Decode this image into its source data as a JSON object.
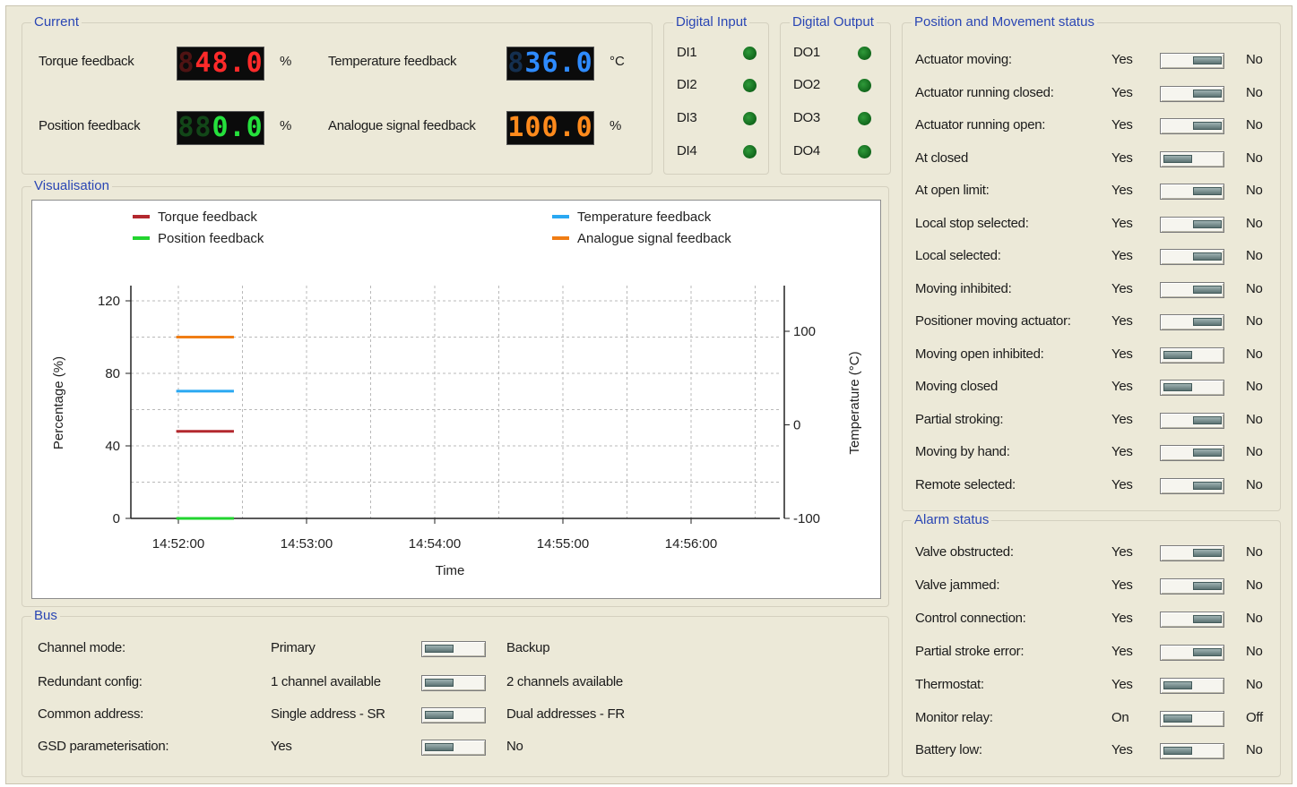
{
  "current": {
    "title": "Current",
    "torque": {
      "label": "Torque feedback",
      "display": "48.0",
      "unit": "%",
      "color": "#ff2a2a"
    },
    "temperature": {
      "label": "Temperature feedback",
      "display": "36.0",
      "unit": "°C",
      "color": "#2e8bff"
    },
    "position": {
      "label": "Position feedback",
      "display": "0.0",
      "unit": "%",
      "color": "#25e03c"
    },
    "analogue": {
      "label": "Analogue signal feedback",
      "display": "100.0",
      "unit": "%",
      "color": "#ff8a1c"
    }
  },
  "digital_input": {
    "title": "Digital Input",
    "items": [
      {
        "label": "DI1",
        "led": "led-icon"
      },
      {
        "label": "DI2",
        "led": "led-icon"
      },
      {
        "label": "DI3",
        "led": "led-icon"
      },
      {
        "label": "DI4",
        "led": "led-icon"
      }
    ]
  },
  "digital_output": {
    "title": "Digital Output",
    "items": [
      {
        "label": "DO1",
        "led": "led-icon"
      },
      {
        "label": "DO2",
        "led": "led-icon"
      },
      {
        "label": "DO3",
        "led": "led-icon"
      },
      {
        "label": "DO4",
        "led": "led-icon"
      }
    ]
  },
  "visualisation": {
    "title": "Visualisation"
  },
  "chart_data": {
    "type": "line",
    "xlabel": "Time",
    "ylabel": "Percentage (%)",
    "y2label": "Temperature (°C)",
    "ylim": [
      0,
      120
    ],
    "y2lim": [
      -100,
      100
    ],
    "yticks": [
      0,
      40,
      80,
      120
    ],
    "y2ticks": [
      -100,
      0,
      100
    ],
    "x_ticks": [
      "14:52:00",
      "14:53:00",
      "14:54:00",
      "14:55:00",
      "14:56:00"
    ],
    "grid": true,
    "legend_position": "top",
    "series": [
      {
        "name": "Torque feedback",
        "color": "#b3282e",
        "axis": "left",
        "x": [
          "14:51:59",
          "14:52:26"
        ],
        "y": [
          48,
          48
        ]
      },
      {
        "name": "Temperature feedback",
        "color": "#2aa8f2",
        "axis": "right",
        "x": [
          "14:51:59",
          "14:52:26"
        ],
        "y": [
          36,
          36
        ]
      },
      {
        "name": "Position feedback",
        "color": "#22d42f",
        "axis": "left",
        "x": [
          "14:51:59",
          "14:52:26"
        ],
        "y": [
          0,
          0
        ]
      },
      {
        "name": "Analogue signal feedback",
        "color": "#f07d14",
        "axis": "left",
        "x": [
          "14:51:59",
          "14:52:26"
        ],
        "y": [
          100,
          100
        ]
      }
    ]
  },
  "bus": {
    "title": "Bus",
    "rows": [
      {
        "label": "Channel mode:",
        "left": "Primary",
        "right": "Backup",
        "state": "left"
      },
      {
        "label": "Redundant config:",
        "left": "1 channel available",
        "right": "2 channels available",
        "state": "left"
      },
      {
        "label": "Common address:",
        "left": "Single address - SR",
        "right": "Dual addresses - FR",
        "state": "left"
      },
      {
        "label": "GSD parameterisation:",
        "left": "Yes",
        "right": "No",
        "state": "left"
      }
    ]
  },
  "movement": {
    "title": "Position and Movement status",
    "rows": [
      {
        "label": "Actuator moving:",
        "yes": "Yes",
        "no": "No",
        "state": "right"
      },
      {
        "label": "Actuator running closed:",
        "yes": "Yes",
        "no": "No",
        "state": "right"
      },
      {
        "label": "Actuator running open:",
        "yes": "Yes",
        "no": "No",
        "state": "right"
      },
      {
        "label": "At closed",
        "yes": "Yes",
        "no": "No",
        "state": "left"
      },
      {
        "label": "At open limit:",
        "yes": "Yes",
        "no": "No",
        "state": "right"
      },
      {
        "label": "Local stop selected:",
        "yes": "Yes",
        "no": "No",
        "state": "right"
      },
      {
        "label": "Local selected:",
        "yes": "Yes",
        "no": "No",
        "state": "right"
      },
      {
        "label": "Moving inhibited:",
        "yes": "Yes",
        "no": "No",
        "state": "right"
      },
      {
        "label": "Positioner moving actuator:",
        "yes": "Yes",
        "no": "No",
        "state": "right"
      },
      {
        "label": "Moving open inhibited:",
        "yes": "Yes",
        "no": "No",
        "state": "left"
      },
      {
        "label": "Moving closed",
        "yes": "Yes",
        "no": "No",
        "state": "left"
      },
      {
        "label": "Partial stroking:",
        "yes": "Yes",
        "no": "No",
        "state": "right"
      },
      {
        "label": "Moving by hand:",
        "yes": "Yes",
        "no": "No",
        "state": "right"
      },
      {
        "label": "Remote selected:",
        "yes": "Yes",
        "no": "No",
        "state": "right"
      }
    ]
  },
  "alarm": {
    "title": "Alarm status",
    "rows": [
      {
        "label": "Valve obstructed:",
        "yes": "Yes",
        "no": "No",
        "state": "right"
      },
      {
        "label": "Valve jammed:",
        "yes": "Yes",
        "no": "No",
        "state": "right"
      },
      {
        "label": "Control connection:",
        "yes": "Yes",
        "no": "No",
        "state": "right"
      },
      {
        "label": "Partial stroke error:",
        "yes": "Yes",
        "no": "No",
        "state": "right"
      },
      {
        "label": "Thermostat:",
        "yes": "Yes",
        "no": "No",
        "state": "left"
      },
      {
        "label": "Monitor relay:",
        "yes": "On",
        "no": "Off",
        "state": "left"
      },
      {
        "label": "Battery low:",
        "yes": "Yes",
        "no": "No",
        "state": "left"
      }
    ]
  }
}
